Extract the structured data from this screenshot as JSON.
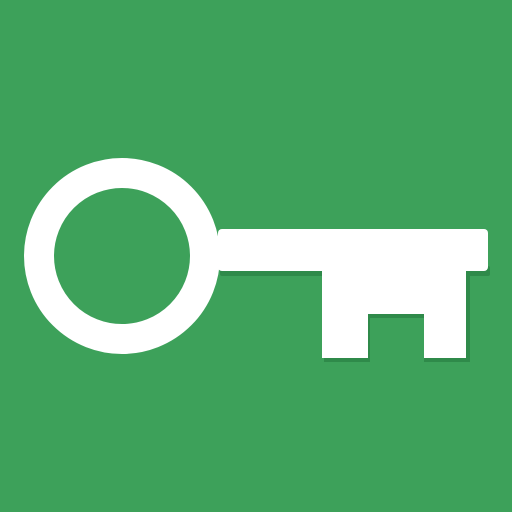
{
  "icon": {
    "name": "key-icon",
    "background_color": "#3da15a",
    "foreground_color": "#ffffff",
    "shadow_color": "#2f8a4a"
  }
}
